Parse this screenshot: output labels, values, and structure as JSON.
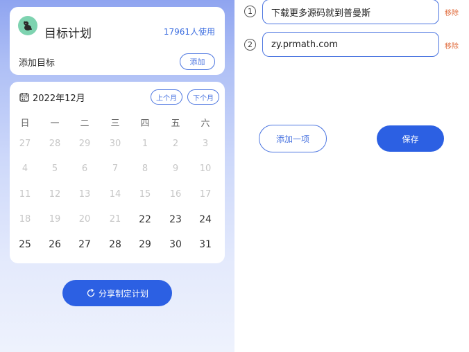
{
  "plan_card": {
    "icon": "dog-avatar-icon",
    "title": "目标计划",
    "users": "17961人使用",
    "add_goal_label": "添加目标",
    "add_button": "添加"
  },
  "calendar": {
    "icon": "calendar-icon",
    "month_label": "2022年12月",
    "prev_button": "上个月",
    "next_button": "下个月",
    "weekdays": [
      "日",
      "一",
      "二",
      "三",
      "四",
      "五",
      "六"
    ],
    "weeks": [
      [
        "27",
        "28",
        "29",
        "30",
        "1",
        "2",
        "3"
      ],
      [
        "4",
        "5",
        "6",
        "7",
        "8",
        "9",
        "10"
      ],
      [
        "11",
        "12",
        "13",
        "14",
        "15",
        "16",
        "17"
      ],
      [
        "18",
        "19",
        "20",
        "21",
        "22",
        "23",
        "24"
      ],
      [
        "25",
        "26",
        "27",
        "28",
        "29",
        "30",
        "31"
      ]
    ],
    "muted_color": "#c6c6c6",
    "active_color": "#333333"
  },
  "share_button": {
    "icon": "refresh-icon",
    "label": "分享制定计划"
  },
  "items": [
    {
      "number": "1",
      "value": "下载更多源码就到普曼斯",
      "remove_label": "移除"
    },
    {
      "number": "2",
      "value": "zy.prmath.com",
      "remove_label": "移除"
    }
  ],
  "add_item_button": "添加一项",
  "save_button": "保存",
  "colors": {
    "accent": "#2c60e3",
    "outline": "#4a74e0",
    "remove": "#e06a3a",
    "icon_bg": "#7ed3b0"
  }
}
